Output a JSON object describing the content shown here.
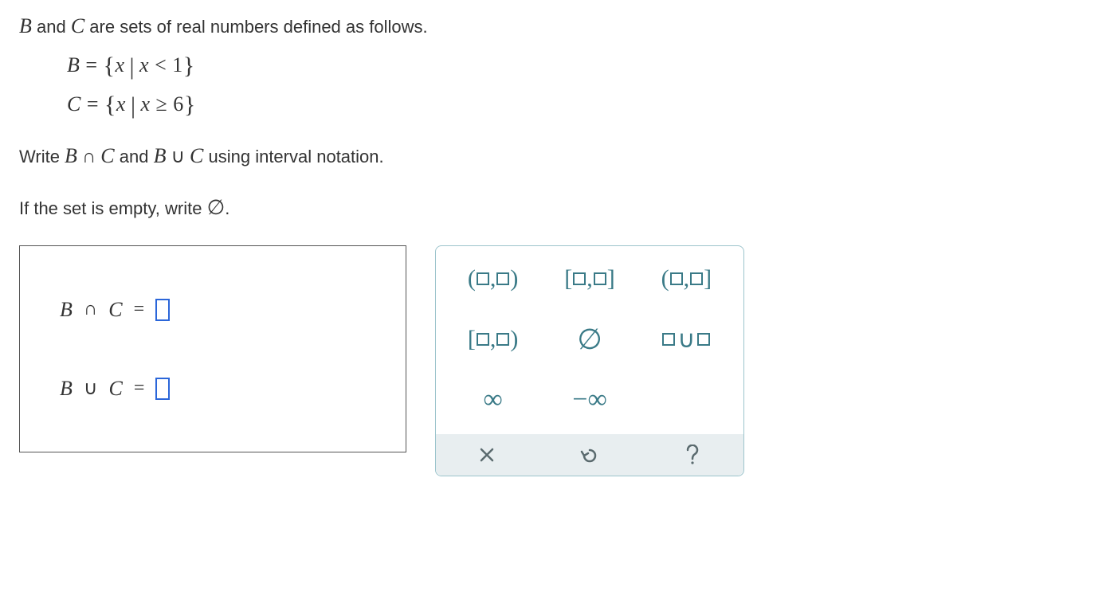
{
  "prompt": {
    "intro_pre": "",
    "var_b": "B",
    "intro_mid": " and ",
    "var_c": "C",
    "intro_post": " are sets of real numbers defined as follows."
  },
  "set_defs": {
    "b_lhs": "B",
    "b_cond": "x < 1",
    "c_lhs": "C",
    "c_cond": "x ≥ 6"
  },
  "instruction": {
    "write": "Write ",
    "b1": "B",
    "cap": " ∩ ",
    "c1": "C",
    "and": " and ",
    "b2": "B",
    "cup": " ∪ ",
    "c2": "C",
    "tail": " using interval notation.",
    "empty_pre": "If the set is empty, write ",
    "empty_sym": "∅",
    "empty_post": "."
  },
  "answers": {
    "line1": {
      "b": "B",
      "op": "∩",
      "c": "C",
      "eq": "="
    },
    "line2": {
      "b": "B",
      "op": "∪",
      "c": "C",
      "eq": "="
    }
  },
  "palette": {
    "open_open": "(▫,▫)",
    "closed_closed": "[▫,▫]",
    "open_closed": "(▫,▫]",
    "closed_open": "[▫,▫)",
    "empty": "∅",
    "union": "▫∪▫",
    "inf": "∞",
    "neg_inf": "−∞"
  },
  "footer": {
    "clear": "×",
    "undo": "↶",
    "help": "?"
  }
}
